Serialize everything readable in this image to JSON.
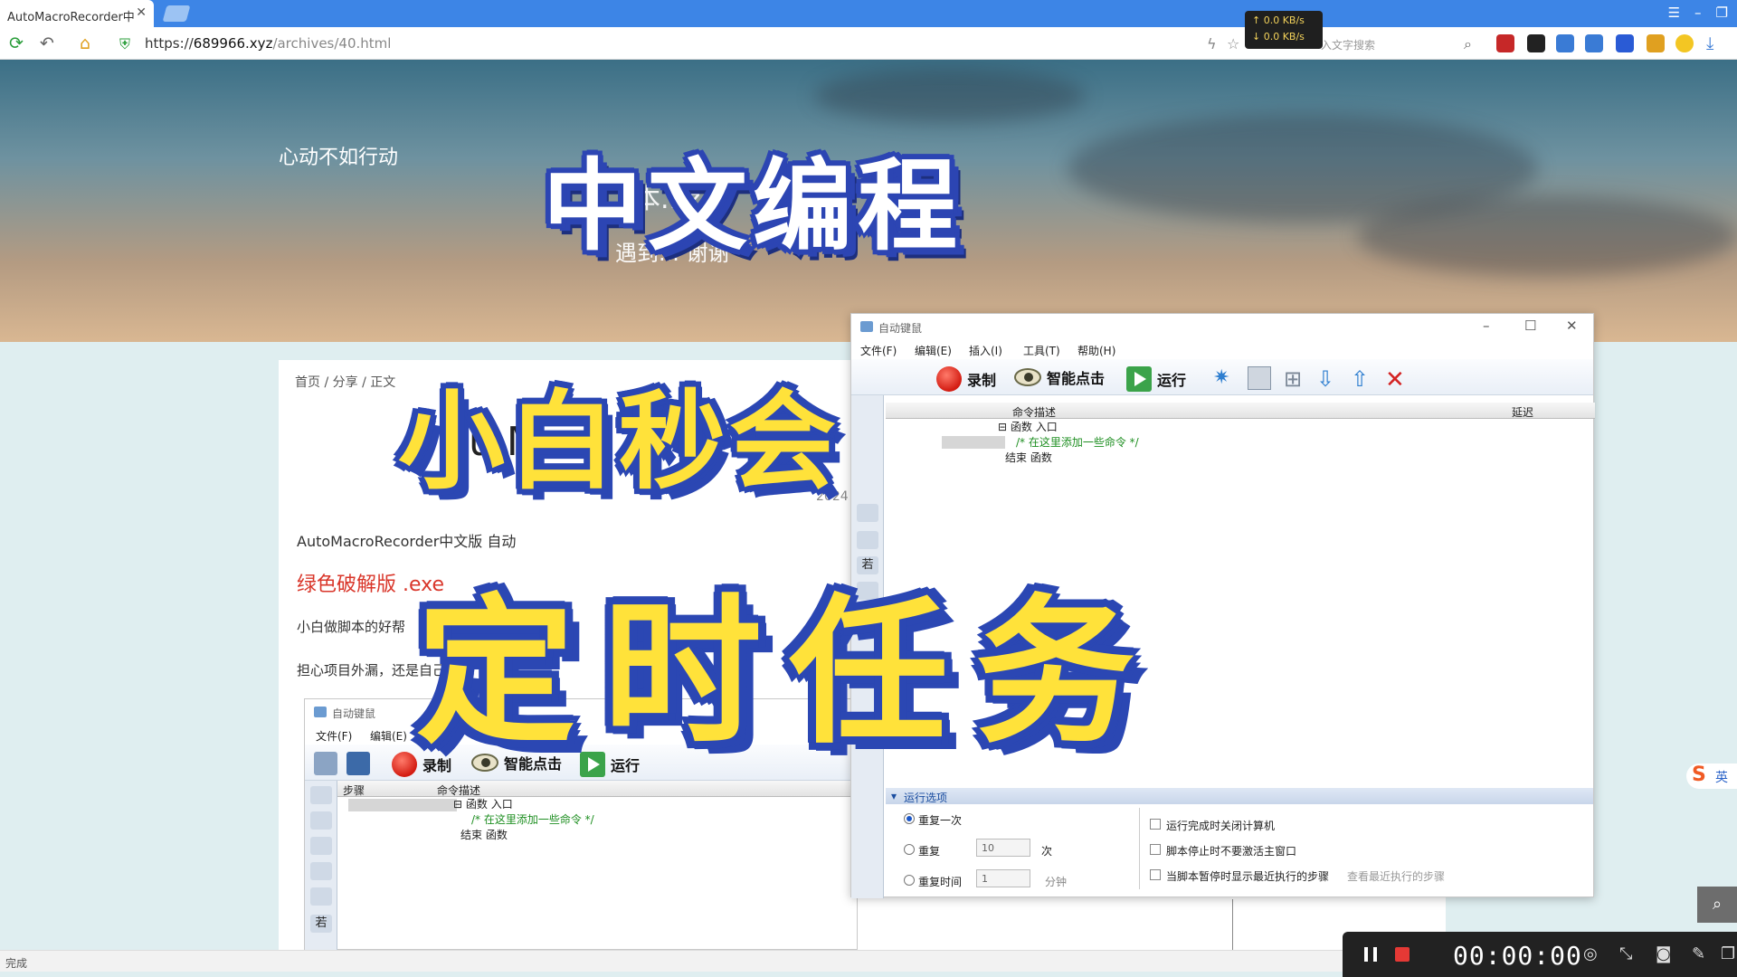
{
  "browser": {
    "tab_title": "AutoMacroRecorder中",
    "tab_close": "✕",
    "url_prefix": "https://",
    "url_domain": "689966.xyz",
    "url_path": "/archives/40.html",
    "search_placeholder": "入文字搜索",
    "net_up": "↑ 0.0 KB/s",
    "net_down": "↓ 0.0 KB/s",
    "status_text": "完成"
  },
  "page": {
    "site_title": "心动不如行动",
    "hero_line1": "本...z",
    "hero_line2": "遇到...  谢谢",
    "breadcrumb": "首页 / 分享 / 正文",
    "article_title": "u  Macr",
    "article_date": "2024",
    "para1": "AutoMacroRecorder中文版 自动",
    "para2": "绿色破解版          .exe",
    "para3": "小白做脚本的好帮",
    "para4": "担心项目外漏，还是自己"
  },
  "overlay": {
    "caption1": "中文编程",
    "caption2": "小白秒会",
    "caption3": "定时任务"
  },
  "app_large": {
    "title": "自动键鼠",
    "menu": [
      "文件(F)",
      "编辑(E)",
      "插入(I)",
      "工具(T)",
      "帮助(H)"
    ],
    "btn_record": "录制",
    "btn_smart": "智能点击",
    "btn_run": "运行",
    "col_desc": "命令描述",
    "col_delay": "延迟",
    "code_func": "函数 入口",
    "code_comment": "/* 在这里添加一些命令 */",
    "code_end": "结束 函数",
    "ls_if": "若",
    "options_title": "运行选项",
    "opt_once": "重复一次",
    "opt_repeat": "重复",
    "opt_repeat_val": "10",
    "opt_repeat_unit": "次",
    "opt_time": "重复时间",
    "opt_time_val": "1",
    "opt_time_unit": "分钟",
    "chk1": "运行完成时关闭计算机",
    "chk2": "脚本停止时不要激活主窗口",
    "chk3": "当脚本暂停时显示最近执行的步骤",
    "chk3_link": "查看最近执行的步骤"
  },
  "app_small": {
    "title": "自动键鼠",
    "menu": [
      "文件(F)",
      "编辑(E)"
    ],
    "btn_record": "录制",
    "btn_smart": "智能点击",
    "btn_run": "运行",
    "col_step": "步骤",
    "col_desc": "命令描述",
    "code_func": "函数 入口",
    "code_comment": "/* 在这里添加一些命令 */",
    "code_end": "结束 函数",
    "ls_if": "若"
  },
  "recorder": {
    "time": "00:00:00"
  },
  "ime": {
    "logo": "S",
    "mode": "英"
  },
  "colors": {
    "caption_yellow": "#ffe23a",
    "caption_outline": "#2b47b3",
    "tabbar": "#3d85e6"
  }
}
